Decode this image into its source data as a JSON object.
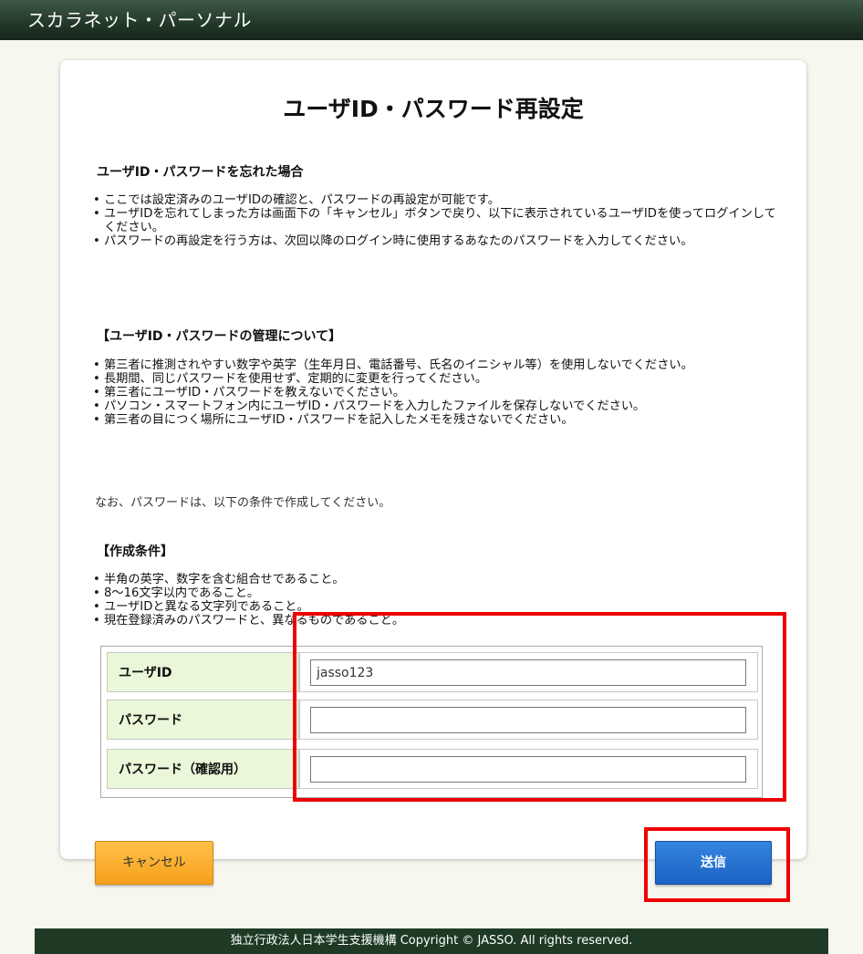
{
  "header": {
    "title": "スカラネット・パーソナル"
  },
  "page": {
    "title": "ユーザID・パスワード再設定"
  },
  "forgot": {
    "heading": "ユーザID・パスワードを忘れた場合",
    "items": [
      "ここでは設定済みのユーザIDの確認と、パスワードの再設定が可能です。",
      "ユーザIDを忘れてしまった方は画面下の「キャンセル」ボタンで戻り、以下に表示されているユーザIDを使ってログインしてください。",
      "パスワードの再設定を行う方は、次回以降のログイン時に使用するあなたのパスワードを入力してください。"
    ]
  },
  "management": {
    "heading": "【ユーザID・パスワードの管理について】",
    "items": [
      "第三者に推測されやすい数字や英字（生年月日、電話番号、氏名のイニシャル等）を使用しないでください。",
      "長期間、同じパスワードを使用せず、定期的に変更を行ってください。",
      "第三者にユーザID・パスワードを教えないでください。",
      "パソコン・スマートフォン内にユーザID・パスワードを入力したファイルを保存しないでください。",
      "第三者の目につく場所にユーザID・パスワードを記入したメモを残さないでください。"
    ]
  },
  "note": "なお、パスワードは、以下の条件で作成してください。",
  "conditions": {
    "heading": "【作成条件】",
    "items": [
      "半角の英字、数字を含む組合せであること。",
      "8～16文字以内であること。",
      "ユーザIDと異なる文字列であること。",
      "現在登録済みのパスワードと、異なるものであること。"
    ]
  },
  "form": {
    "userid_label": "ユーザID",
    "userid_value": "jasso123",
    "password_label": "パスワード",
    "password_value": "",
    "confirm_label": "パスワード（確認用）",
    "confirm_value": ""
  },
  "buttons": {
    "cancel": "キャンセル",
    "submit": "送信"
  },
  "footer": {
    "text": "独立行政法人日本学生支援機構 Copyright © JASSO. All rights reserved."
  },
  "colors": {
    "highlight": "#ee0000",
    "submit": "#1f6fd0",
    "cancel": "#f7a51e",
    "label_bg": "#eaf7d8"
  }
}
